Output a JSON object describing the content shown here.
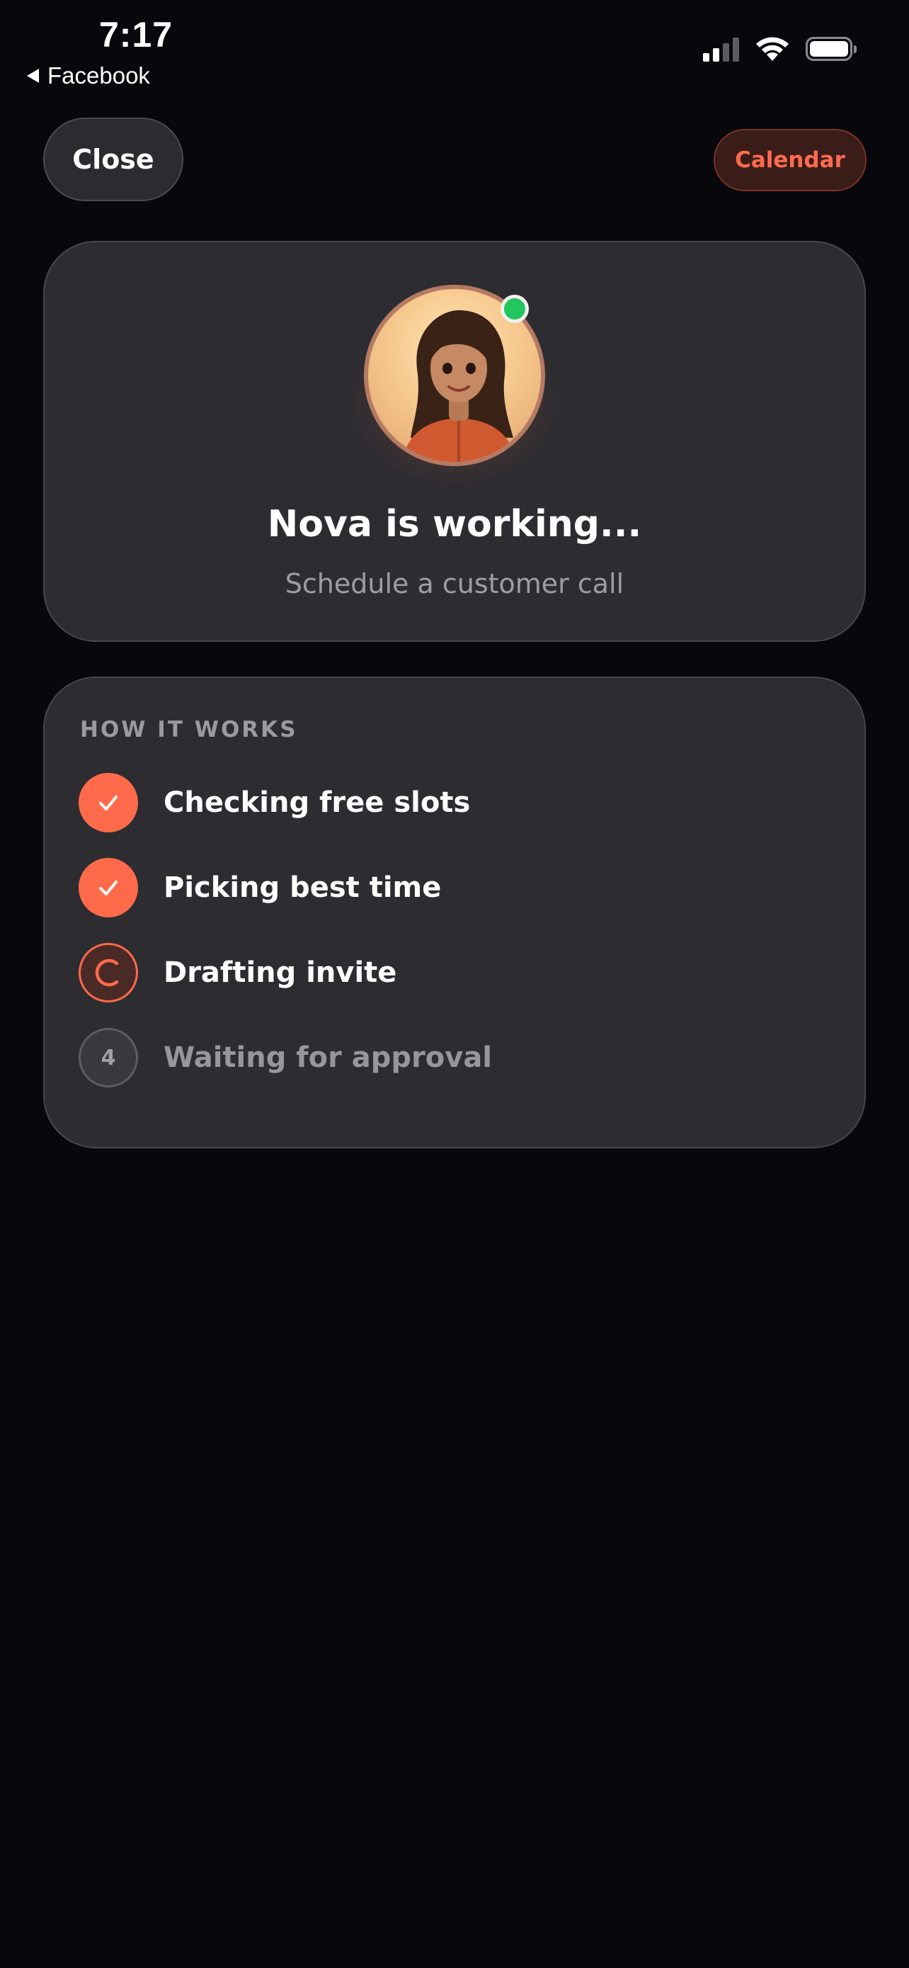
{
  "status_bar": {
    "time": "7:17",
    "back_app": "Facebook",
    "icons": [
      "cellular-signal-icon",
      "wifi-icon",
      "battery-icon"
    ]
  },
  "header": {
    "close_label": "Close",
    "calendar_label": "Calendar"
  },
  "agent": {
    "title": "Nova is working...",
    "subtitle": "Schedule a customer call",
    "online": true,
    "status_color": "#22c55e"
  },
  "how_it_works": {
    "section_label": "HOW IT WORKS",
    "steps": [
      {
        "label": "Checking free slots",
        "state": "done"
      },
      {
        "label": "Picking best time",
        "state": "done"
      },
      {
        "label": "Drafting invite",
        "state": "in-progress"
      },
      {
        "number": "4",
        "label": "Waiting for approval",
        "state": "pending"
      }
    ]
  },
  "colors": {
    "background": "#08080c",
    "card": "#2c2c31",
    "accent": "#ff6a4a",
    "muted_text": "#9d9da3"
  }
}
